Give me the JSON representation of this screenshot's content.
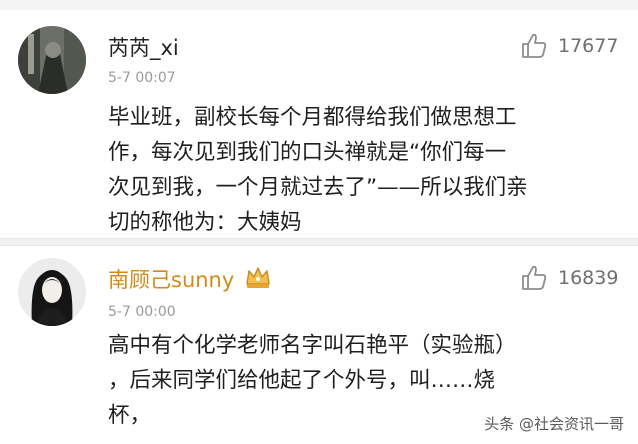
{
  "comments": [
    {
      "username": "芮芮_xi",
      "timestamp": "5-7 00:07",
      "likes": "17677",
      "lines": [
        "毕业班，副校长每个月都得给我们做思想工",
        "作，每次见到我们的口头禅就是“你们每一",
        "次见到我，一个月就过去了”——所以我们亲",
        "切的称他为：大姨妈"
      ]
    },
    {
      "username": "南顾己sunny",
      "timestamp": "5-7 00:00",
      "likes": "16839",
      "lines": [
        "高中有个化学老师名字叫石艳平（实验瓶）",
        "，后来同学们给他起了个外号，叫……烧",
        "杯，"
      ]
    }
  ],
  "watermark": "头条 @社会资讯一哥",
  "colors": {
    "vip_name": "#d38a1a",
    "crown": "#e6a532",
    "text": "#1f1f1f",
    "meta": "#9a9a9a"
  },
  "icons": {
    "like": "thumbs-up-icon",
    "badge": "crown-badge-icon"
  }
}
